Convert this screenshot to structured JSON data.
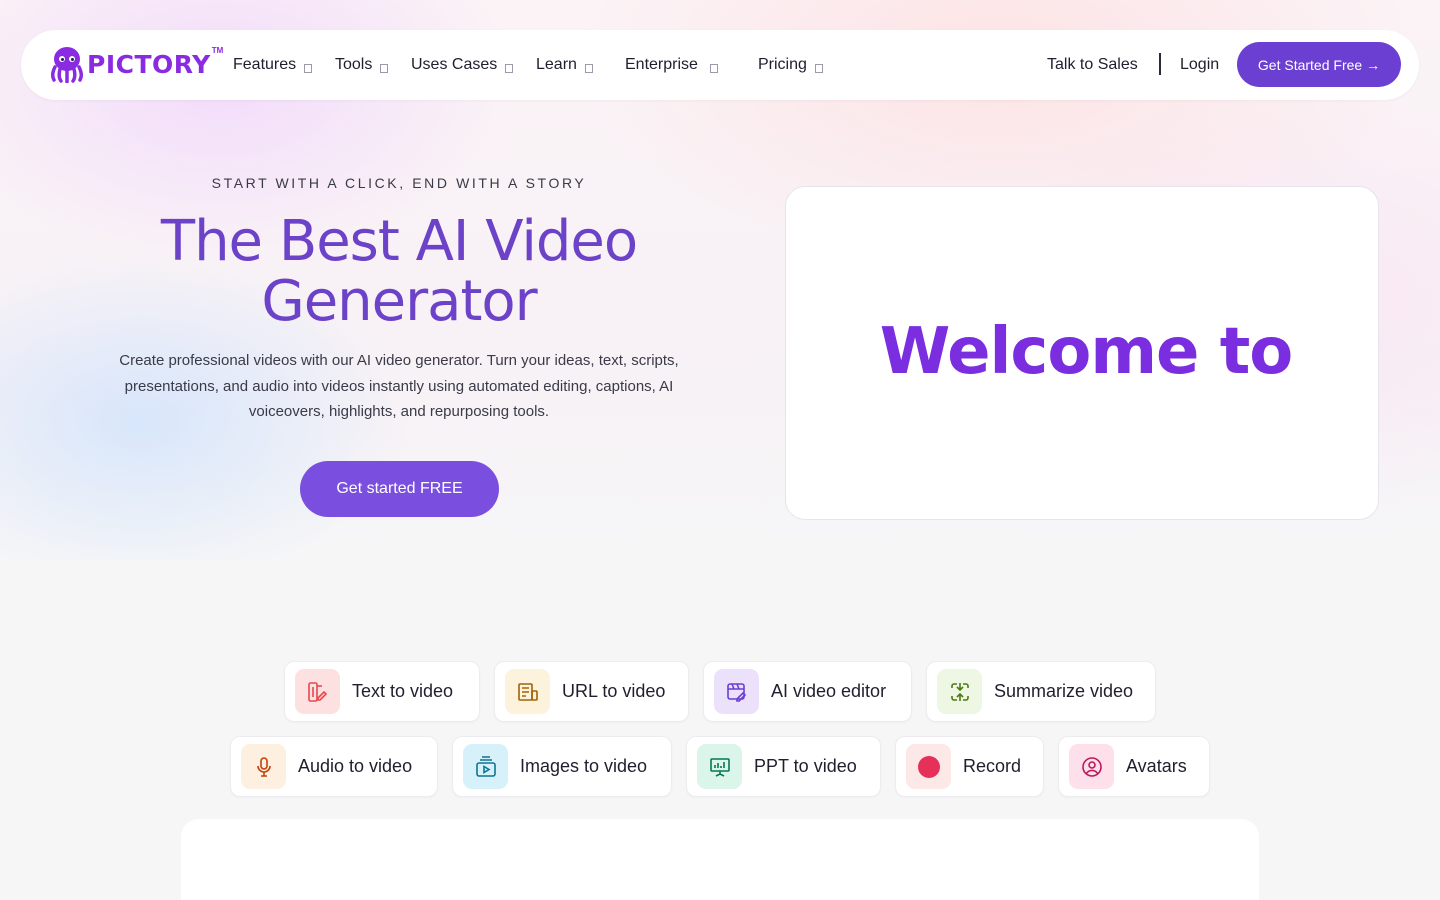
{
  "brand": {
    "name": "PICTORY",
    "tm": "TM",
    "color": "#8a2be2"
  },
  "nav": {
    "items": [
      {
        "label": "Features"
      },
      {
        "label": "Tools"
      },
      {
        "label": "Uses Cases"
      },
      {
        "label": "Learn"
      },
      {
        "label": "Enterprise"
      },
      {
        "label": "Pricing"
      }
    ],
    "talk_to_sales": "Talk to Sales",
    "login": "Login",
    "cta": "Get Started Free →"
  },
  "hero": {
    "eyebrow": "START WITH A CLICK, END WITH A STORY",
    "title": "The Best AI Video Generator",
    "description": "Create professional videos with our AI video generator. Turn your ideas, text, scripts, presentations, and audio into videos instantly using automated editing, captions, AI voiceovers, highlights, and repurposing tools.",
    "cta": "Get started FREE",
    "video_text": "Welcome to",
    "accent": "#6b42c8"
  },
  "tools": [
    {
      "label": "Text to video",
      "icon": "text-to-video-icon",
      "bg": "#fde0e0",
      "fg": "#e5484d"
    },
    {
      "label": "URL to video",
      "icon": "url-to-video-icon",
      "bg": "#fdf3dc",
      "fg": "#a16207"
    },
    {
      "label": "AI video editor",
      "icon": "ai-video-editor-icon",
      "bg": "#ece1fb",
      "fg": "#6b3fd1"
    },
    {
      "label": "Summarize video",
      "icon": "summarize-video-icon",
      "bg": "#eef6e4",
      "fg": "#4d7c0f"
    },
    {
      "label": "Audio to video",
      "icon": "microphone-icon",
      "bg": "#fdf0e0",
      "fg": "#c2410c"
    },
    {
      "label": "Images to video",
      "icon": "images-to-video-icon",
      "bg": "#d7f1fb",
      "fg": "#0e7490"
    },
    {
      "label": "PPT to video",
      "icon": "presentation-icon",
      "bg": "#dcf5ea",
      "fg": "#047857"
    },
    {
      "label": "Record",
      "icon": "record-icon",
      "bg": "#fde8e8",
      "fg": "#e5305a"
    },
    {
      "label": "Avatars",
      "icon": "avatar-icon",
      "bg": "#fde0ea",
      "fg": "#be185d"
    }
  ]
}
